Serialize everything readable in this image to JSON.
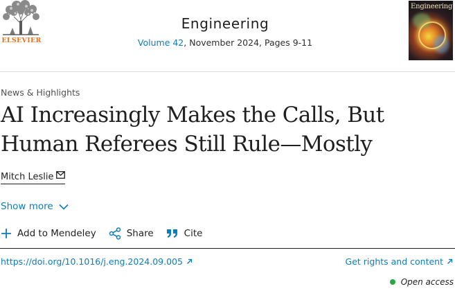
{
  "header": {
    "publisher": "ELSEVIER",
    "journal_title": "Engineering",
    "volume_link": "Volume 42",
    "issue_rest": ", November 2024, Pages 9-11",
    "cover_title": "Engineering"
  },
  "article": {
    "type": "News & Highlights",
    "title": "AI Increasingly Makes the Calls, But Human Referees Still Rule—Mostly",
    "author": "Mitch Leslie",
    "show_more": "Show more"
  },
  "actions": {
    "mendeley": "Add to Mendeley",
    "share": "Share",
    "cite": "Cite"
  },
  "links": {
    "doi": "https://doi.org/10.1016/j.eng.2024.09.005",
    "rights": "Get rights and content",
    "open_access": "Open access"
  },
  "colors": {
    "link": "#0c7dbb",
    "publisher_orange": "#e9711c",
    "open_access_green": "#29a745"
  },
  "icons": [
    "elsevier-tree-logo",
    "mail-icon",
    "chevron-down-icon",
    "plus-icon",
    "share-icon",
    "quote-icon",
    "external-arrow-icon"
  ]
}
